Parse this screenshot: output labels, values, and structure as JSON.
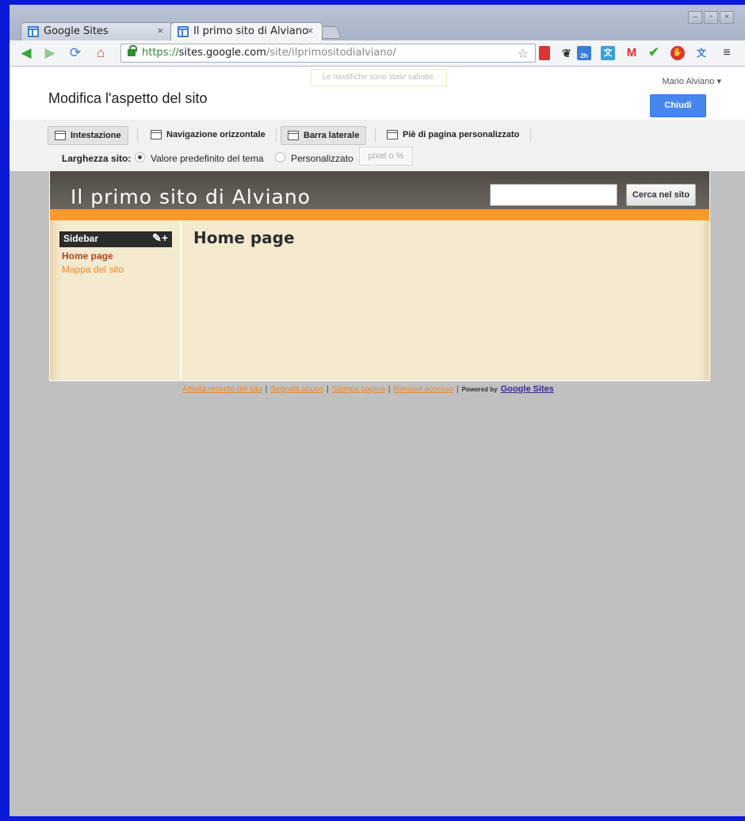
{
  "browser": {
    "tabs": [
      {
        "title": "Google Sites",
        "close": "×"
      },
      {
        "title": "Il primo sito di Alviano",
        "close": "×"
      }
    ],
    "url": {
      "scheme": "https://",
      "host": "sites.google.com",
      "path": "/site/ilprimositodialviano/"
    },
    "extensions": [
      "bookmark-red-icon",
      "evernote-icon",
      "calendar-icon",
      "translate-icon",
      "gmail-icon",
      "check-icon",
      "stop-icon",
      "translate-icon",
      "menu-icon"
    ],
    "calendar_badge": "2h"
  },
  "editor": {
    "saved_message": "Le modifiche sono state salvate.",
    "user": "Mario Alviano",
    "heading": "Modifica l'aspetto del sito",
    "close_label": "Chiudi",
    "tabs": [
      {
        "label": "Intestazione",
        "selected": true
      },
      {
        "label": "Navigazione orizzontale",
        "selected": false
      },
      {
        "label": "Barra laterale",
        "selected": true
      },
      {
        "label": "Piè di pagina personalizzato",
        "selected": false
      }
    ],
    "width_label": "Larghezza sito:",
    "width_options": [
      {
        "label": "Valore predefinito del tema",
        "checked": true
      },
      {
        "label": "Personalizzato",
        "checked": false
      }
    ],
    "width_placeholder": "pixel o %"
  },
  "site": {
    "title": "Il primo sito di Alviano",
    "search_button": "Cerca nel sito",
    "sidebar": {
      "title": "Sidebar",
      "tools": "✎+",
      "links": [
        {
          "label": "Home page",
          "current": true
        },
        {
          "label": "Mappa del sito",
          "current": false
        }
      ]
    },
    "page_title": "Home page",
    "footer": {
      "links": [
        "Attività recente del sito",
        "Segnala abuso",
        "Stampa pagina",
        "Rimuovi accesso"
      ],
      "separator": "|",
      "powered_by": "Powered by",
      "brand": "Google Sites"
    }
  }
}
